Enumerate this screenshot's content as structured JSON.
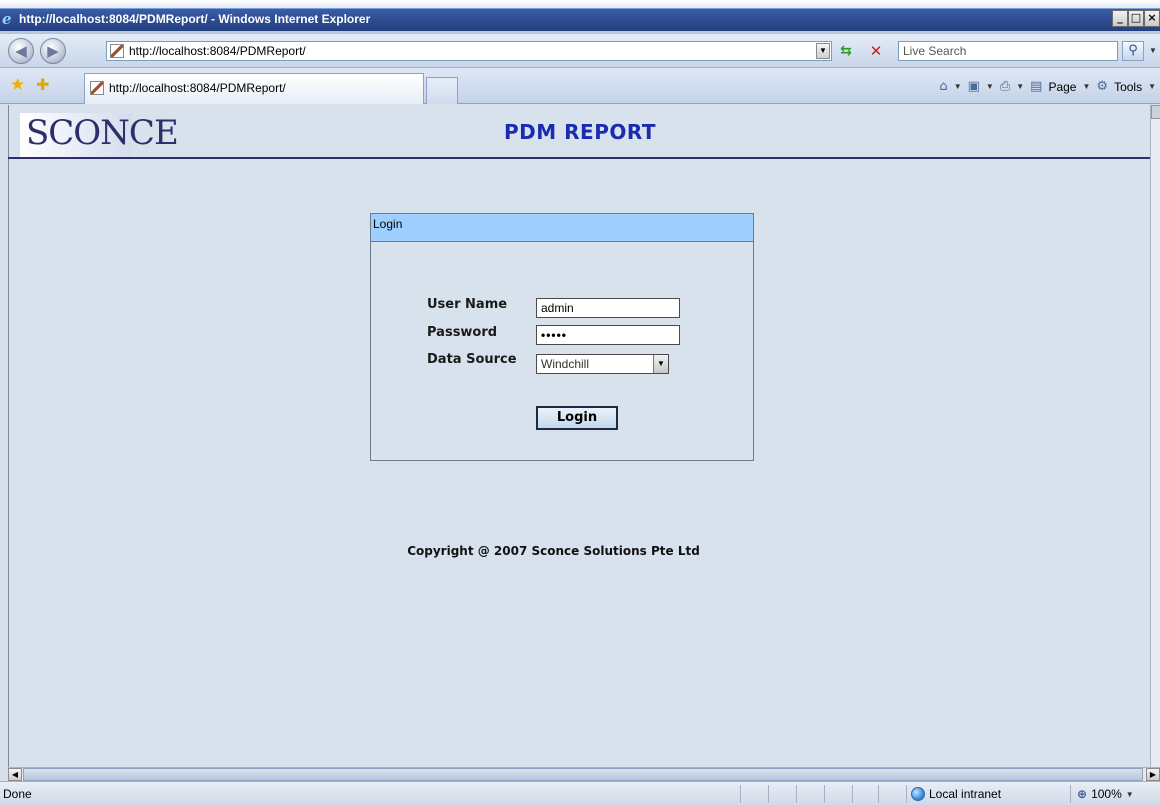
{
  "window": {
    "title": "http://localhost:8084/PDMReport/ - Windows Internet Explorer",
    "min": "_",
    "max": "□",
    "close": "×"
  },
  "nav": {
    "address": "http://localhost:8084/PDMReport/",
    "search_placeholder": "Live Search"
  },
  "tabs": {
    "active": "http://localhost:8084/PDMReport/"
  },
  "command_bar": {
    "page": "Page",
    "tools": "Tools"
  },
  "page": {
    "logo_text": "SCONCE",
    "title": "PDM REPORT",
    "login": {
      "header": "Login",
      "username_label": "User Name",
      "username_value": "admin",
      "password_label": "Password",
      "password_value": "•••••",
      "datasource_label": "Data Source",
      "datasource_value": "Windchill",
      "button": "Login"
    },
    "copyright": "Copyright @ 2007  Sconce Solutions Pte Ltd"
  },
  "status": {
    "text": "Done",
    "zone": "Local intranet",
    "zoom": "100%"
  }
}
